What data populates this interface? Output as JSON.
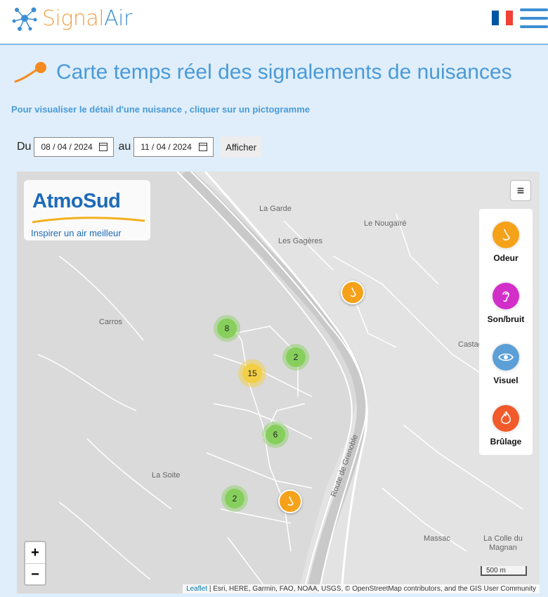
{
  "app": {
    "name_part1": "Signal",
    "name_part2": "Air"
  },
  "header": {
    "flag_colors": [
      "#0055a4",
      "#ffffff",
      "#ef4135"
    ]
  },
  "page": {
    "title": "Carte temps réel des signalements de nuisances",
    "subtitle": "Pour visualiser le détail d'une nuisance , cliquer sur  un pictogramme"
  },
  "filters": {
    "from_label": "Du",
    "from_value": "08 / 04 / 2024",
    "to_label": "au",
    "to_value": "11 / 04 / 2024",
    "submit_label": "Afficher"
  },
  "map": {
    "brand": {
      "name": "AtmoSud",
      "tagline": "Inspirer un air meilleur"
    },
    "places": [
      "La Garde",
      "Le Nougaïré",
      "Les Gagères",
      "Carros",
      "Castagniers",
      "La Soite",
      "Massac",
      "La Colle du Magnan",
      "Route de Grenoble"
    ],
    "clusters": [
      {
        "count": "8",
        "color": "#86cf5c"
      },
      {
        "count": "2",
        "color": "#86cf5c"
      },
      {
        "count": "15",
        "color": "#f2cf45"
      },
      {
        "count": "6",
        "color": "#86cf5c"
      },
      {
        "count": "2",
        "color": "#86cf5c"
      }
    ],
    "legend": [
      {
        "label": "Odeur",
        "color": "#f5a21a",
        "icon": "nose-icon"
      },
      {
        "label": "Son/bruit",
        "color": "#d22fc9",
        "icon": "ear-icon"
      },
      {
        "label": "Visuel",
        "color": "#5b9fd6",
        "icon": "eye-icon"
      },
      {
        "label": "Brûlage",
        "color": "#f15a2b",
        "icon": "flame-icon"
      }
    ],
    "zoom_in": "+",
    "zoom_out": "−",
    "scale": "500 m",
    "attribution_link": "Leaflet",
    "attribution_text": " | Esri, HERE, Garmin, FAO, NOAA, USGS, © OpenStreetMap contributors, and the GIS User Community"
  }
}
